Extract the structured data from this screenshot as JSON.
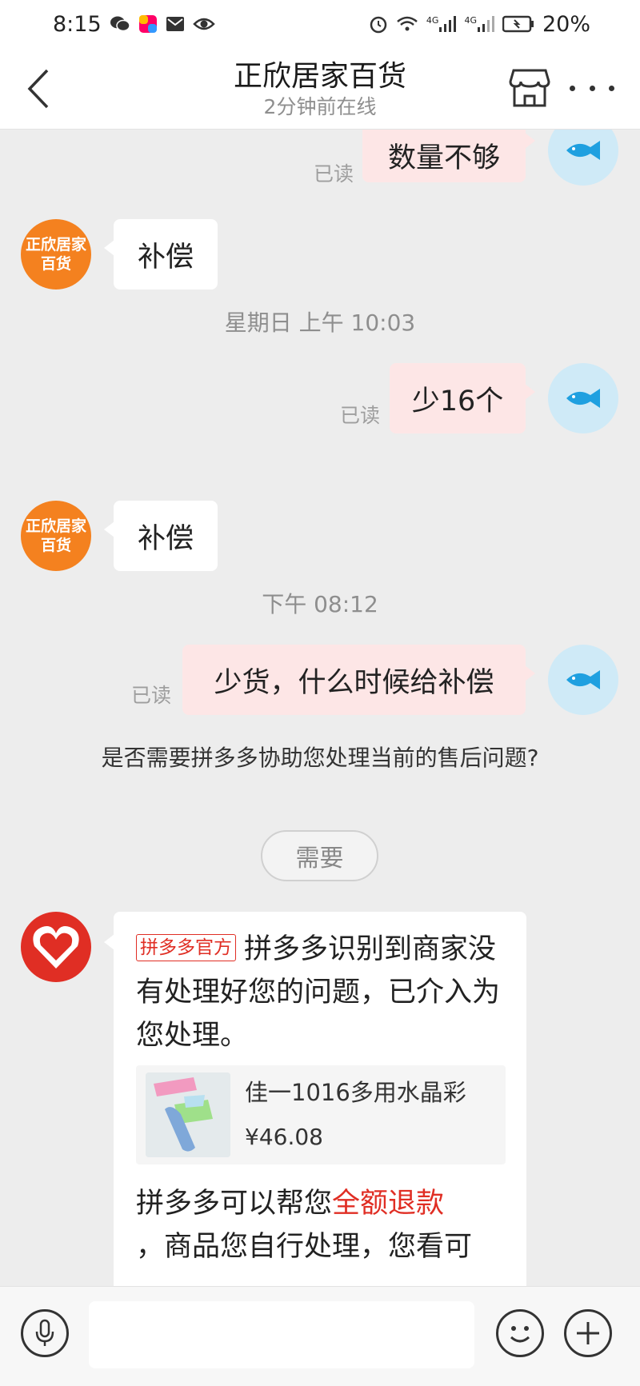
{
  "status_bar": {
    "time": "8:15",
    "battery": "20%",
    "net1": "4G",
    "net2": "4G"
  },
  "header": {
    "title": "正欣居家百货",
    "subtitle": "2分钟前在线"
  },
  "shop_avatar": {
    "line1": "正欣居家",
    "line2": "百货"
  },
  "messages": {
    "m1": {
      "text": "数量不够",
      "read": "已读"
    },
    "m2": {
      "text": "补偿"
    },
    "ts1": "星期日 上午 10:03",
    "m3": {
      "text": "少16个",
      "read": "已读"
    },
    "m4": {
      "text": "补偿"
    },
    "ts2": "下午 08:12",
    "m5": {
      "text": "少货，什么时候给补偿",
      "read": "已读"
    }
  },
  "system": {
    "question": "是否需要拼多多协助您处理当前的售后问题?",
    "need_button": "需要"
  },
  "official": {
    "tag": "拼多多官方",
    "text": "拼多多识别到商家没有处理好您的问题，已介入为您处理。",
    "product_name": "佳一1016多用水晶彩",
    "product_price": "¥46.08",
    "refund_prefix": "拼多多可以帮您",
    "refund_highlight": "全额退款",
    "refund_suffix": "，商品您自行处理，您看可"
  },
  "colors": {
    "accent_red": "#e02e24",
    "outgoing_bubble": "#fde6e6",
    "shop_avatar": "#f4811f",
    "fish_avatar": "#cfeaf7"
  },
  "icons": {
    "back": "chevron-left-icon",
    "store": "store-icon",
    "more": "more-icon",
    "voice": "microphone-icon",
    "emoji": "smile-icon",
    "plus": "plus-icon"
  }
}
